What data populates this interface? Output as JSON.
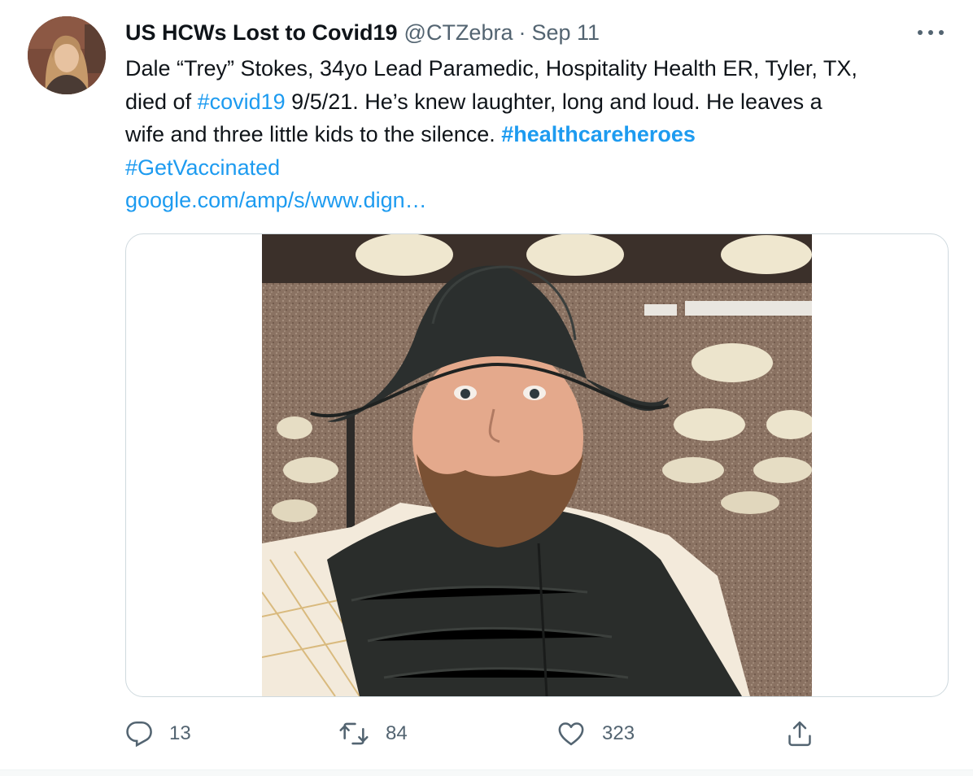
{
  "tweet": {
    "display_name": "US HCWs Lost to Covid19",
    "handle": "@CTZebra",
    "separator": "·",
    "date": "Sep 11",
    "text": {
      "line1": "Dale “Trey” Stokes, 34yo Lead Paramedic, Hospitality Health ER, Tyler, TX,",
      "line2_prefix": "died of ",
      "line2_hashtag": "#covid19",
      "line2_suffix": " 9/5/21. He’s knew laughter, long and loud.  He leaves a",
      "line3_text": "wife and three little kids to the silence. ",
      "line3_hashtag": "#healthcareheroes",
      "line4_hashtag": "#GetVaccinated",
      "link": "google.com/amp/s/www.dign…"
    },
    "actions": {
      "reply_count": "13",
      "retweet_count": "84",
      "like_count": "323"
    }
  },
  "icons": {
    "more": "more-horizontal-icon",
    "reply": "reply-icon",
    "retweet": "retweet-icon",
    "like": "heart-icon",
    "share": "share-icon"
  },
  "colors": {
    "link": "#1d9bf0",
    "secondary_text": "#536471",
    "primary_text": "#0f1419",
    "border": "#cfd9de"
  }
}
